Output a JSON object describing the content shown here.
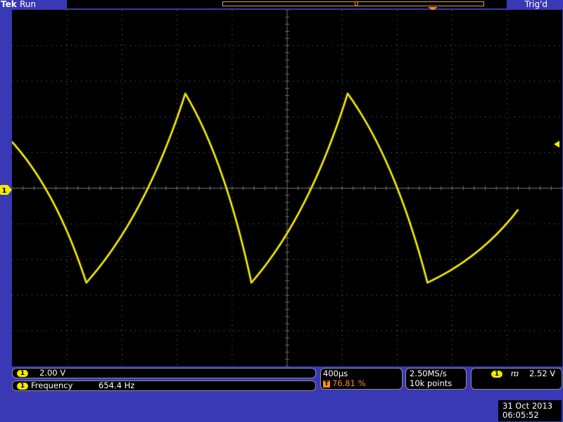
{
  "header": {
    "brand": "Tek",
    "run_state": "Run",
    "trigger_state": "Trig'd",
    "trigger_marker_glyph": "T"
  },
  "channel": {
    "marker": "1",
    "trace_color": "#f2e900"
  },
  "readouts": {
    "vertical_scale": "2.00 V",
    "measurement_label": "Frequency",
    "measurement_value": "654.4 Hz",
    "time_div": "400µs",
    "trigger_position": "76.81 %",
    "sample_rate": "2.50MS/s",
    "record_length": "10k points",
    "trigger_slope_glyph": "ⴊ",
    "trigger_level": "2.52 V"
  },
  "datetime": {
    "date": "31 Oct  2013",
    "time": "06:05:52"
  },
  "chart_data": {
    "type": "line",
    "waveform": "triangle",
    "series": [
      {
        "x": [
          0.0,
          1.35,
          3.15,
          4.35,
          6.1,
          7.55,
          9.2
        ],
        "y": [
          1.3,
          -2.65,
          2.65,
          -2.65,
          2.65,
          -2.65,
          -0.6
        ]
      }
    ],
    "xlim": [
      0,
      10
    ],
    "ylim": [
      -5,
      5
    ],
    "grid": true,
    "colors": {
      "trace": "#f2e900",
      "grid": "#6a6a6a",
      "background": "#000000"
    }
  }
}
